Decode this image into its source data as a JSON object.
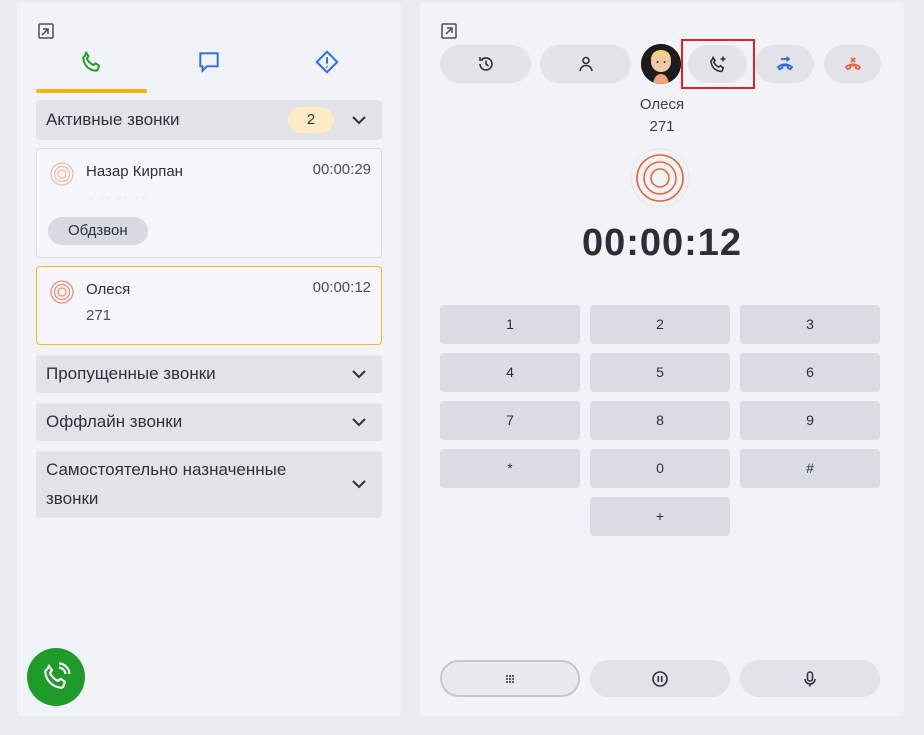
{
  "left_panel": {
    "tabs": [
      "phone-icon",
      "chat-icon",
      "alert-icon"
    ],
    "sections": {
      "active": {
        "label": "Активные звонки",
        "count": "2"
      },
      "missed": {
        "label": "Пропущенные звонки"
      },
      "offline": {
        "label": "Оффлайн звонки"
      },
      "self_assigned": {
        "label_line1": "Самостоятельно назначенные",
        "label_line2": "звонки"
      }
    },
    "calls": [
      {
        "name": "Назар Кирпан",
        "time": "00:00:29",
        "number_masked": "· ·· ·· ··",
        "tag": "Обдзвон"
      },
      {
        "name": "Олеся",
        "time": "00:00:12",
        "number": "271"
      }
    ]
  },
  "right_panel": {
    "contact": {
      "name": "Олеся",
      "number": "271"
    },
    "timer": "00:00:12",
    "keypad": [
      "1",
      "2",
      "3",
      "4",
      "5",
      "6",
      "7",
      "8",
      "9",
      "*",
      "0",
      "#",
      "+"
    ],
    "toolbar_icons": [
      "history-icon",
      "contact-icon",
      "avatar",
      "add-call-icon",
      "transfer-call-icon",
      "hangup-icon"
    ],
    "bottom_icons": [
      "keypad-icon",
      "pause-icon",
      "microphone-icon"
    ]
  },
  "colors": {
    "accent": "#f4b400",
    "green": "#1f9b2a",
    "blue": "#2d6cdf",
    "red": "#e0212b",
    "orange": "#e8663c"
  }
}
